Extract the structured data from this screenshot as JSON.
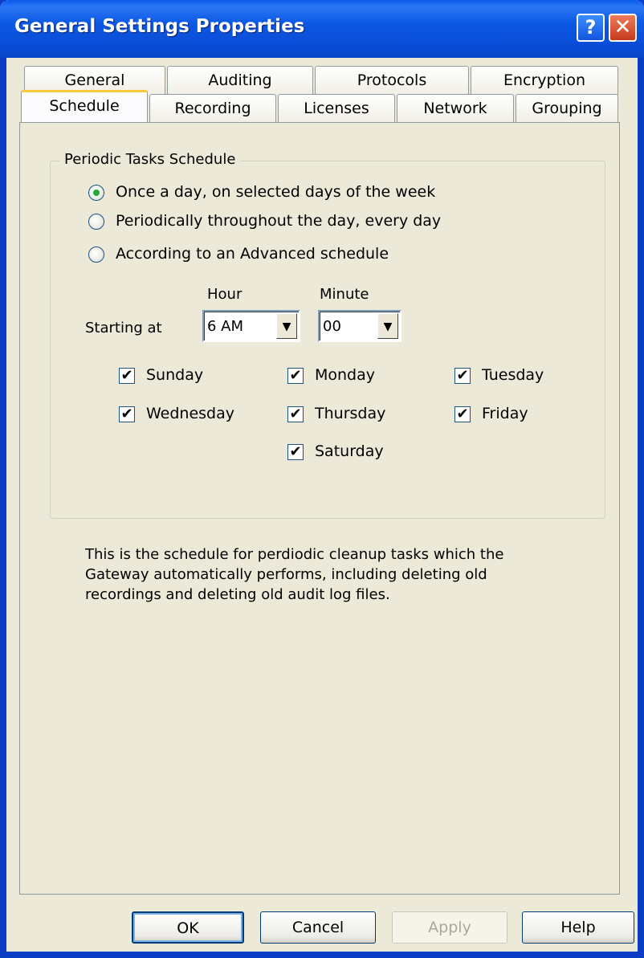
{
  "window": {
    "title": "General Settings Properties"
  },
  "titlebar": {
    "help_glyph": "?",
    "close_glyph": "✕"
  },
  "tabs_back": [
    "General",
    "Auditing",
    "Protocols",
    "Encryption"
  ],
  "tabs_front": [
    "Schedule",
    "Recording",
    "Licenses",
    "Network",
    "Grouping"
  ],
  "active_tab": "Schedule",
  "group": {
    "legend": "Periodic Tasks Schedule",
    "radios": [
      {
        "label": "Once a day, on selected days of the week",
        "checked": true
      },
      {
        "label": "Periodically throughout the day, every day",
        "checked": false
      },
      {
        "label": "According to an Advanced schedule",
        "checked": false
      }
    ],
    "starting_at_label": "Starting at",
    "hour": {
      "label": "Hour",
      "value": "6 AM"
    },
    "minute": {
      "label": "Minute",
      "value": "00"
    },
    "days": [
      {
        "label": "Sunday",
        "checked": true
      },
      {
        "label": "Monday",
        "checked": true
      },
      {
        "label": "Tuesday",
        "checked": true
      },
      {
        "label": "Wednesday",
        "checked": true
      },
      {
        "label": "Thursday",
        "checked": true
      },
      {
        "label": "Friday",
        "checked": true
      },
      {
        "label": "Saturday",
        "checked": true
      }
    ]
  },
  "description": "This is the schedule for perdiodic cleanup tasks which the Gateway automatically performs, including deleting old recordings and deleting old audit log files.",
  "buttons": {
    "ok": "OK",
    "cancel": "Cancel",
    "apply": "Apply",
    "help": "Help"
  },
  "glyphs": {
    "dropdown": "▼",
    "check": "✔"
  }
}
